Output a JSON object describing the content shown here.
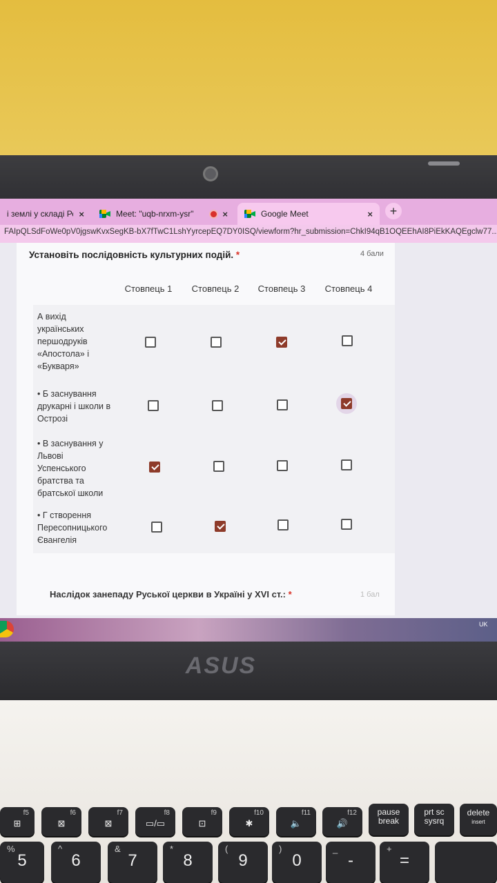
{
  "browser": {
    "tabs": [
      {
        "label": "і землі у складі Речі П",
        "close": "×"
      },
      {
        "label": "Meet: \"uqb-nrxm-ysr\"",
        "close": "×"
      },
      {
        "label": "Google Meet",
        "close": "×"
      }
    ],
    "new_tab": "+",
    "url": "FAIpQLSdFoWe0pV0jgswKvxSegKB-bX7fTwC1LshYyrcepEQ7DY0ISQ/viewform?hr_submission=ChkI94qB1OQEEhAI8PiEkKAQEgclw77..."
  },
  "form": {
    "question1": {
      "title": "Установіть послідовність культурних подій.",
      "required_mark": "*",
      "points": "4 бали",
      "columns": [
        "Стовпець 1",
        "Стовпець 2",
        "Стовпець 3",
        "Стовпець 4"
      ],
      "rows": [
        {
          "label": "А вихід українських першодруків «Апостола» і «Букваря»",
          "checked": [
            false,
            false,
            true,
            false
          ]
        },
        {
          "label": "• Б заснування друкарні і школи в Острозі",
          "checked": [
            false,
            false,
            false,
            true
          ]
        },
        {
          "label": "• В заснування у Львові Успенського братства та братської школи",
          "checked": [
            true,
            false,
            false,
            false
          ]
        },
        {
          "label": "• Г створення Пересопницького Євангелія",
          "checked": [
            false,
            true,
            false,
            false
          ]
        }
      ]
    },
    "question2": {
      "title": "Наслідок занепаду Руської церкви в Україні у XVI ст.:",
      "required_mark": "*",
      "points": "1 бал"
    }
  },
  "taskbar": {
    "lang": "UK"
  },
  "laptop": {
    "brand": "ASUS"
  },
  "keyboard": {
    "fn_row": [
      {
        "top": "f5",
        "main": "⊞"
      },
      {
        "top": "f6",
        "main": "⊠"
      },
      {
        "top": "f7",
        "main": "⊠"
      },
      {
        "top": "f8",
        "main": "▭/▭"
      },
      {
        "top": "f9",
        "main": "⊡"
      },
      {
        "top": "f10",
        "main": "✱"
      },
      {
        "top": "f11",
        "main": "🔈"
      },
      {
        "top": "f12",
        "main": "🔊"
      },
      {
        "top": "",
        "main": "pause break"
      },
      {
        "top": "",
        "main": "prt sc sysrq"
      },
      {
        "top": "insert",
        "main": "delete"
      }
    ],
    "num_row": [
      {
        "alt": "%",
        "main": "5"
      },
      {
        "alt": "^",
        "main": "6"
      },
      {
        "alt": "&",
        "main": "7"
      },
      {
        "alt": "*",
        "main": "8"
      },
      {
        "alt": "(",
        "main": "9"
      },
      {
        "alt": ")",
        "main": "0"
      },
      {
        "alt": "_",
        "main": "-"
      },
      {
        "alt": "+",
        "main": "="
      }
    ]
  }
}
